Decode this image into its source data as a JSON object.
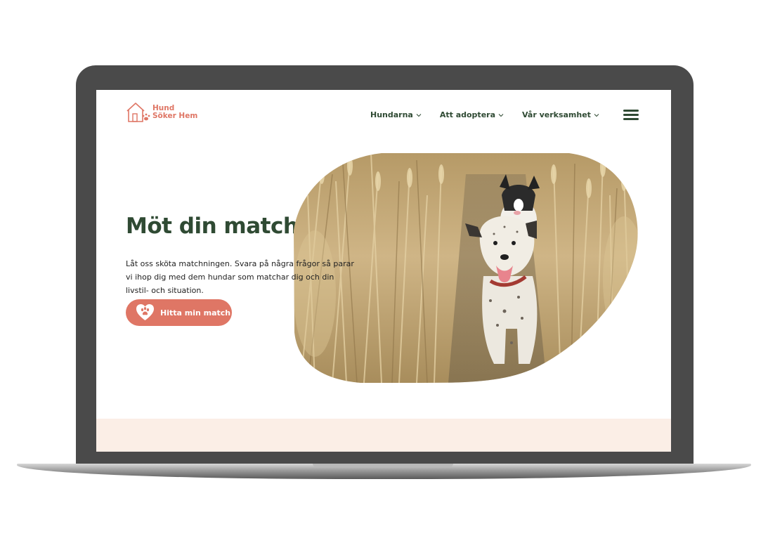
{
  "brand": {
    "name_line1": "Hund",
    "name_line2": "Söker Hem",
    "color": "#df7665"
  },
  "nav": {
    "items": [
      {
        "label": "Hundarna",
        "icon": "chevron-down-icon"
      },
      {
        "label": "Att adoptera",
        "icon": "chevron-down-icon"
      },
      {
        "label": "Vår verksamhet",
        "icon": "chevron-down-icon"
      }
    ],
    "menu_icon": "hamburger-menu-icon",
    "text_color": "#2f4a33"
  },
  "hero": {
    "title": "Möt din match",
    "text": "Låt oss sköta matchningen. Svara på några frågor så parar vi ihop dig med dem hundar som matchar dig och din livstil- och situation.",
    "cta_label": "Hitta min match",
    "cta_icon": "heart-paw-icon",
    "cta_color": "#df7665",
    "image": "dogs-running-in-wheat-field"
  },
  "colors": {
    "frame": "#4a4a4a",
    "band": "#fbeee6",
    "heading": "#2f4a33"
  }
}
